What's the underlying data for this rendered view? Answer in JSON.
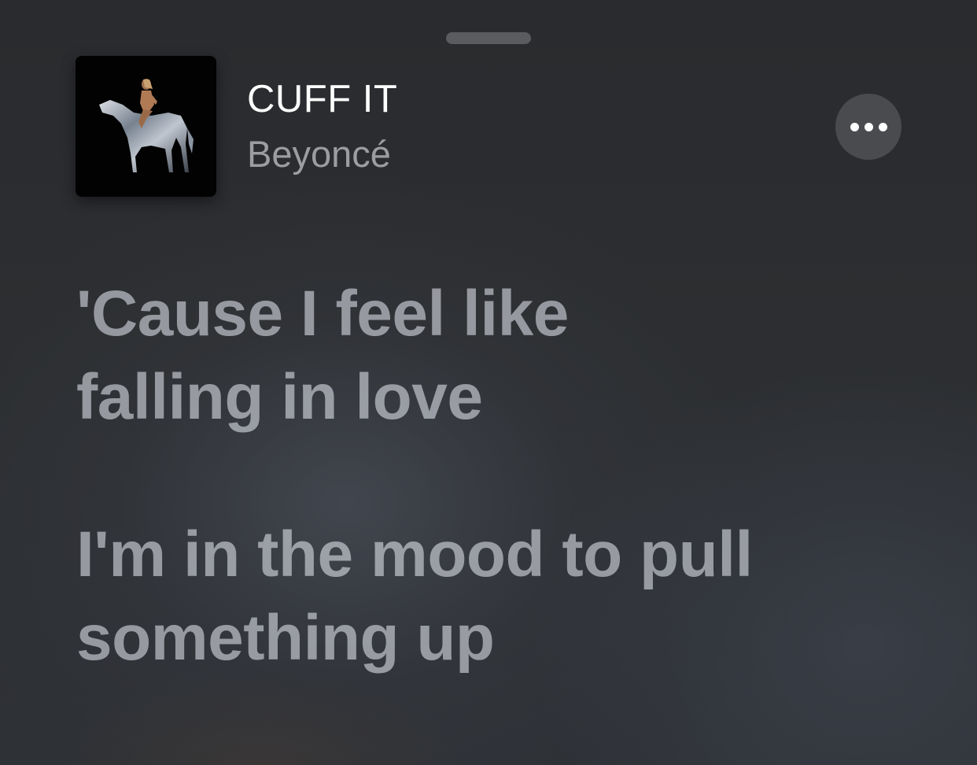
{
  "now_playing": {
    "title": "CUFF IT",
    "artist": "Beyoncé",
    "album_art_icon": "album-cover-horse-rider",
    "more_icon": "ellipsis-icon"
  },
  "lyrics": {
    "lines": [
      "'Cause I feel like",
      "falling in love",
      "I'm in the mood to pull",
      "something up"
    ]
  },
  "colors": {
    "title": "#ffffff",
    "artist": "#9c9da1",
    "more_button_bg": "#494b4f"
  }
}
